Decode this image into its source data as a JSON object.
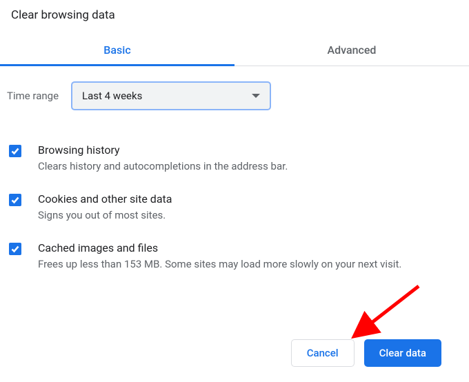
{
  "dialog": {
    "title": "Clear browsing data"
  },
  "tabs": {
    "basic": "Basic",
    "advanced": "Advanced"
  },
  "time_range": {
    "label": "Time range",
    "value": "Last 4 weeks"
  },
  "options": [
    {
      "title": "Browsing history",
      "desc": "Clears history and autocompletions in the address bar."
    },
    {
      "title": "Cookies and other site data",
      "desc": "Signs you out of most sites."
    },
    {
      "title": "Cached images and files",
      "desc": "Frees up less than 153 MB. Some sites may load more slowly on your next visit."
    }
  ],
  "buttons": {
    "cancel": "Cancel",
    "clear": "Clear data"
  }
}
